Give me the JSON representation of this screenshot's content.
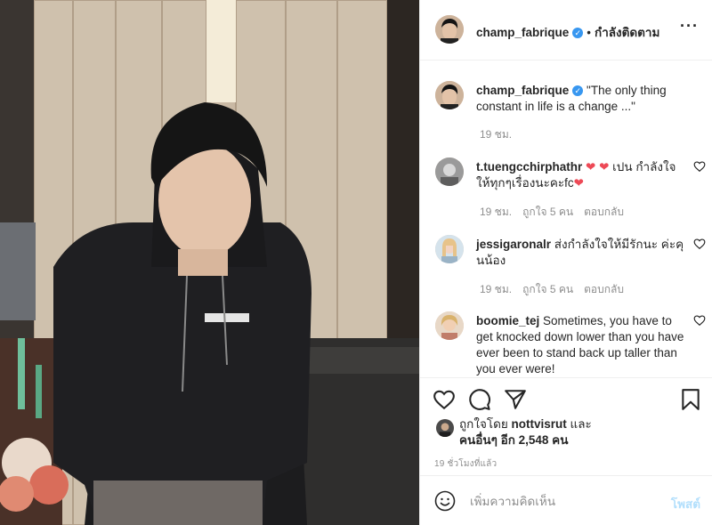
{
  "post": {
    "username": "champ_fabrique",
    "separator": "•",
    "follow_state": "กำลังติดตาม",
    "more_icon": "more-horizontal-icon"
  },
  "caption": {
    "username": "champ_fabrique",
    "text": "\"The only thing constant in life is a change ...\"",
    "time": "19 ชม."
  },
  "comments": [
    {
      "username": "t.tuengcchirphathr",
      "text_before": " ",
      "text_after": " เปน กำลังใจให้ทุกๆเรื่องนะคะfc",
      "time": "19 ชม.",
      "likes": "ถูกใจ 5 คน",
      "reply": "ตอบกลับ"
    },
    {
      "username": "jessigaronalr",
      "text_before": " ส่งกำลังใจให้มีรักนะ ค่ะคุนน้อง",
      "time": "19 ชม.",
      "likes": "ถูกใจ 5 คน",
      "reply": "ตอบกลับ"
    },
    {
      "username": "boomie_tej",
      "text_before": " Sometimes, you have to get knocked down lower than you have ever been to stand back up taller than you ever were!"
    }
  ],
  "likes_line1_prefix": "ถูกใจโดย ",
  "likes_user": "nottvisrut",
  "likes_line1_suffix": " และ",
  "likes_line2": "คนอื่นๆ อีก 2,548 คน",
  "time_ago": "19 ชั่วโมงที่แล้ว",
  "add_comment": {
    "placeholder": "เพิ่มความคิดเห็น",
    "post_label": "โพสต์"
  },
  "colors": {
    "heart_red": "#ed4956",
    "verified_blue": "#3897f0",
    "post_disabled": "#b2dffc"
  }
}
